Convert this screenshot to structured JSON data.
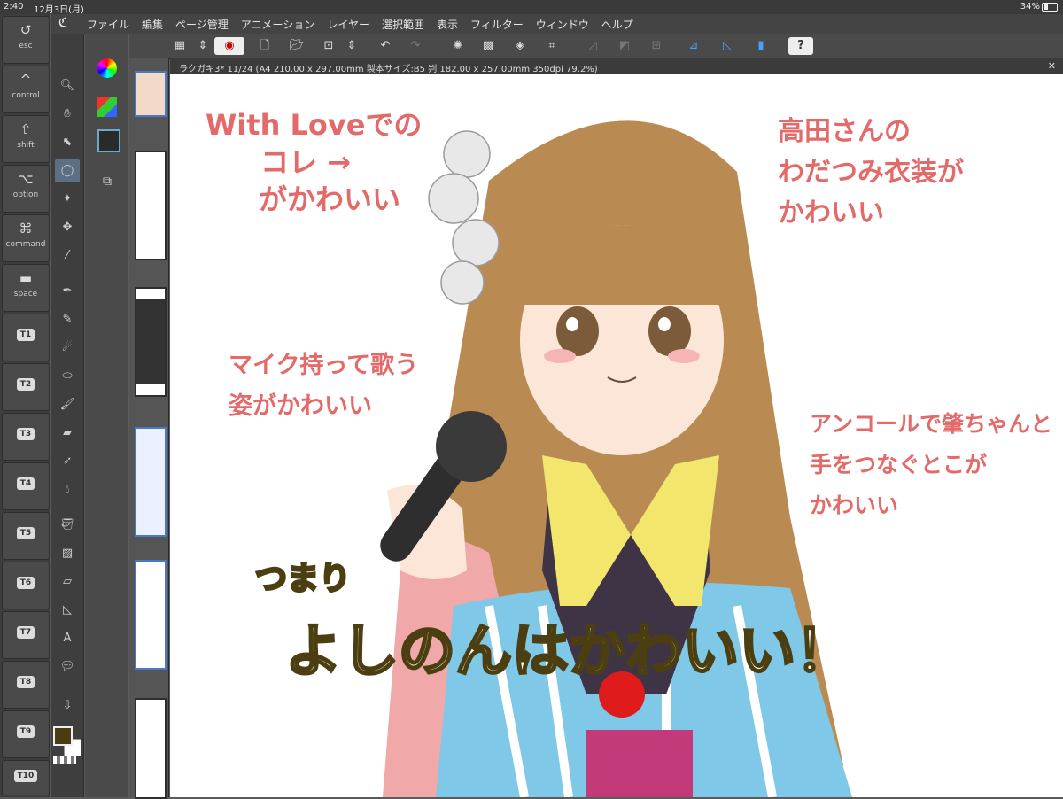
{
  "status": {
    "time": "2:40",
    "date": "12月3日(月)",
    "battery": "34%"
  },
  "menu": {
    "items": [
      "ファイル",
      "編集",
      "ページ管理",
      "アニメーション",
      "レイヤー",
      "選択範囲",
      "表示",
      "フィルター",
      "ウィンドウ",
      "ヘルプ"
    ]
  },
  "modifier_keys": [
    {
      "glyph": "↺",
      "label": "esc"
    },
    {
      "glyph": "^",
      "label": "control"
    },
    {
      "glyph": "⇧",
      "label": "shift"
    },
    {
      "glyph": "⌥",
      "label": "option"
    },
    {
      "glyph": "⌘",
      "label": "command"
    },
    {
      "glyph": "▬",
      "label": "space"
    },
    {
      "label": "T1"
    },
    {
      "label": "T2"
    },
    {
      "label": "T3"
    },
    {
      "label": "T4"
    },
    {
      "label": "T5"
    },
    {
      "label": "T6"
    },
    {
      "label": "T7"
    },
    {
      "label": "T8"
    },
    {
      "label": "T9"
    },
    {
      "label": "T10"
    }
  ],
  "document_tab": {
    "label": "ラクガキ3* 11/24 (A4 210.00 x 297.00mm 製本サイズ:B5 判 182.00 x 257.00mm 350dpi 79.2%)"
  },
  "colors": {
    "main_color": "#4a3b12",
    "sub_color": "#ffffff",
    "selection": "#5d6f85",
    "annotation_red": "#e46a6a"
  },
  "canvas": {
    "notes": [
      {
        "lines": [
          "With Loveでの",
          "コレ →",
          "がかわいい"
        ]
      },
      {
        "lines": [
          "高田さんの",
          "わだつみ衣装が",
          "かわいい"
        ]
      },
      {
        "lines": [
          "マイク持って歌う",
          "姿がかわいい"
        ]
      },
      {
        "lines": [
          "アンコールで肇ちゃんと",
          "手をつなぐとこが",
          "かわいい"
        ]
      }
    ],
    "small_caption": "つまり",
    "main_caption": "よしのんはかわいい！"
  }
}
